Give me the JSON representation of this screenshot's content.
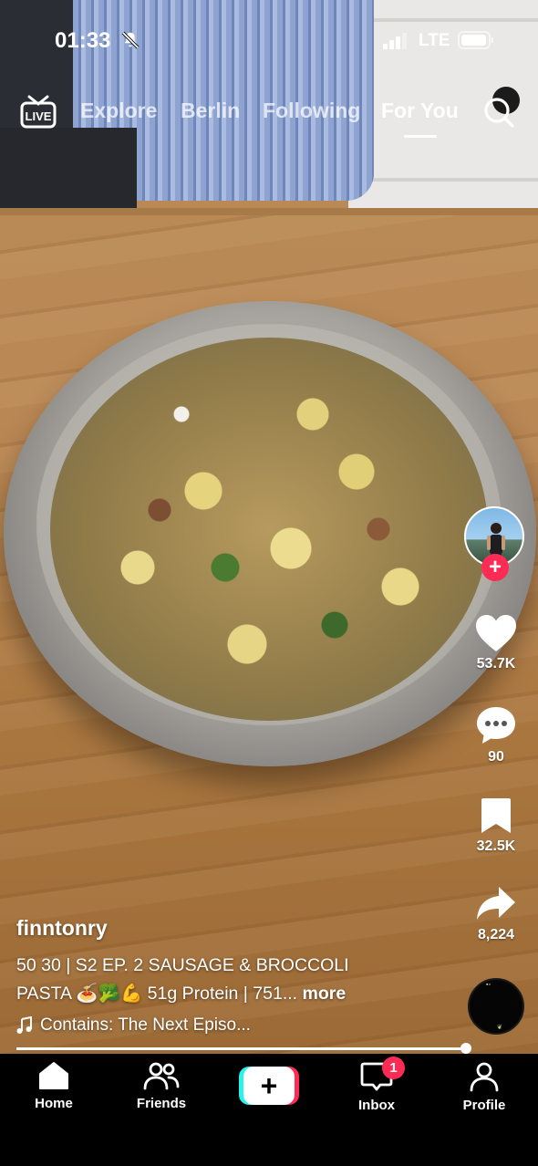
{
  "status_bar": {
    "time": "01:33",
    "network": "LTE"
  },
  "top_nav": {
    "tabs": [
      {
        "label": "Explore",
        "active": false
      },
      {
        "label": "Berlin",
        "active": false
      },
      {
        "label": "Following",
        "active": false
      },
      {
        "label": "For You",
        "active": true
      }
    ]
  },
  "actions": {
    "likes": "53.7K",
    "comments": "90",
    "saves": "32.5K",
    "shares": "8,224"
  },
  "post": {
    "username": "finntonry",
    "description_line1": "50 30 | S2 EP. 2 SAUSAGE & BROCCOLI",
    "description_line2": "PASTA 🍝🥦💪 51g Protein | 751...",
    "more_label": "more",
    "sound": "Contains: The Next Episo..."
  },
  "playback": {
    "progress_percent": 99
  },
  "bottom_nav": {
    "home": "Home",
    "friends": "Friends",
    "inbox": "Inbox",
    "inbox_badge": "1",
    "profile": "Profile"
  },
  "colors": {
    "accent": "#fe2c55",
    "create_left": "#25f4ee",
    "create_right": "#fe2c55"
  }
}
